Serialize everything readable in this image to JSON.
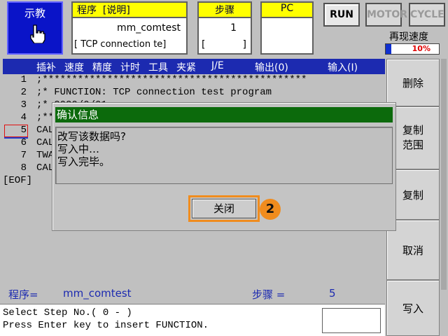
{
  "header": {
    "mode_label": "示教",
    "program": {
      "caption": "程序",
      "caption_note": "[说明]",
      "name": "mm_comtest",
      "comment": "[ TCP connection te]"
    },
    "step": {
      "caption": "步骤",
      "value": "1",
      "bracket_left": "[",
      "bracket_right": "]"
    },
    "pc": {
      "caption": "PC"
    },
    "buttons": {
      "run": "RUN",
      "motor": "MOTOR",
      "cycle": "CYCLE"
    },
    "speed": {
      "label": "再现速度",
      "value": "10%",
      "fraction": 0.1
    }
  },
  "menubar": {
    "items": [
      "插补",
      "速度",
      "精度",
      "计时",
      "工具",
      "夹紧",
      "J/E",
      "输出(0)",
      "输入(I)"
    ]
  },
  "listing": {
    "lines": [
      {
        "num": "1",
        "text": ";*********************************************"
      },
      {
        "num": "2",
        "text": ";* FUNCTION: TCP connection test program"
      },
      {
        "num": "3",
        "text": ";* 2020/0/01"
      },
      {
        "num": "4",
        "text": ";**"
      },
      {
        "num": "5",
        "text": "CAL"
      },
      {
        "num": "6",
        "text": "CAL"
      },
      {
        "num": "7",
        "text": "TWA"
      },
      {
        "num": "8",
        "text": "CAL"
      }
    ],
    "eof": "[EOF]"
  },
  "side_buttons": {
    "delete": "删除",
    "copy_range": "复制\n范围",
    "copy": "复制",
    "cancel": "取消",
    "write": "写入"
  },
  "status": {
    "program_label": "程序=",
    "program_value": "mm_comtest",
    "step_label": "步骤 =",
    "step_value": "5"
  },
  "message": {
    "line1": "Select Step No.( 0 - )",
    "line2": "Press Enter key to insert FUNCTION."
  },
  "dialog": {
    "title": "确认信息",
    "lines": [
      "改写该数据吗?",
      "写入中…",
      "写入完毕。"
    ],
    "close_label": "关闭",
    "step_marker": "2"
  },
  "colors": {
    "mode_box": "#0a14c8",
    "caption_yellow": "#ffff00",
    "menubar_blue": "#1c2ab0",
    "dialog_title_green": "#0c6a0c",
    "highlight_orange": "#f08c1e"
  }
}
